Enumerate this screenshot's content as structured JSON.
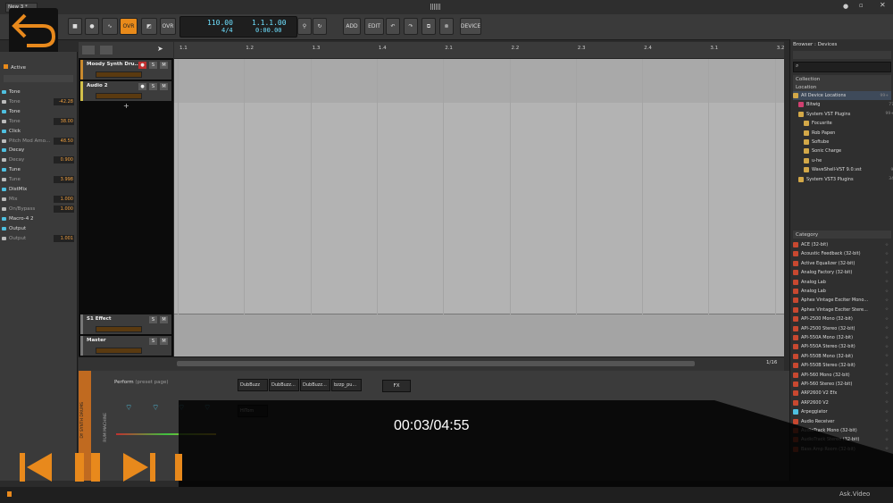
{
  "app": {
    "menu_label": "New 3 *",
    "accent": "#e88a1a"
  },
  "transport": {
    "ovr1": "OVR",
    "ovr2": "OVR",
    "tempo": "110.00",
    "time_sig": "4/4",
    "position": "1.1.1.00",
    "time": "0:00.00",
    "add": "ADD",
    "edit": "EDIT",
    "device": "DEVICE"
  },
  "inspector": {
    "active_label": "Active",
    "rows": [
      {
        "label": "Tone",
        "kind": "head",
        "value": ""
      },
      {
        "label": "Tone",
        "kind": "sub",
        "value": "-42.28"
      },
      {
        "label": "Tone",
        "kind": "head",
        "value": ""
      },
      {
        "label": "Tone",
        "kind": "sub",
        "value": "38.00"
      },
      {
        "label": "Click",
        "kind": "head",
        "value": ""
      },
      {
        "label": "Pitch Mod Amo...",
        "kind": "sub",
        "value": "48.50"
      },
      {
        "label": "Decay",
        "kind": "head",
        "value": ""
      },
      {
        "label": "Decay",
        "kind": "sub",
        "value": "0.900"
      },
      {
        "label": "Tune",
        "kind": "head",
        "value": ""
      },
      {
        "label": "Tune",
        "kind": "sub",
        "value": "3.998"
      },
      {
        "label": "DistMix",
        "kind": "head",
        "value": ""
      },
      {
        "label": "Mix",
        "kind": "sub",
        "value": "1.000"
      },
      {
        "label": "On/Bypass",
        "kind": "sub",
        "value": "1.000"
      },
      {
        "label": "Macro-4 2",
        "kind": "head",
        "value": ""
      },
      {
        "label": "Output",
        "kind": "head",
        "value": ""
      },
      {
        "label": "Output",
        "kind": "sub",
        "value": "1.001"
      }
    ]
  },
  "tracks": [
    {
      "name": "Moody Synth Dru...",
      "color": "#c98a2e"
    },
    {
      "name": "Audio 2",
      "color": "#d2c04a"
    }
  ],
  "fx_tracks": [
    {
      "name": "S1 Effect"
    },
    {
      "name": "Master"
    }
  ],
  "track_buttons": {
    "s": "S",
    "m": "M"
  },
  "ruler": [
    "1.1",
    "1.2",
    "1.3",
    "1.4",
    "2.1",
    "2.2",
    "2.3",
    "2.4",
    "3.1",
    "3.2"
  ],
  "arranger_footer": {
    "grid": "1/16"
  },
  "browser": {
    "title": "Browser : Devices",
    "collection": "Collection",
    "location": "Location",
    "locations": [
      {
        "name": "All Device Locations",
        "count": "99+"
      },
      {
        "name": "Bitwig",
        "count": "77"
      },
      {
        "name": "System VST Plugins",
        "count": "99+"
      },
      {
        "name": "Focusrite",
        "count": "4"
      },
      {
        "name": "Rob Papen",
        "count": "6"
      },
      {
        "name": "Softube",
        "count": "17"
      },
      {
        "name": "Sonic Charge",
        "count": "2"
      },
      {
        "name": "u-he",
        "count": "3"
      },
      {
        "name": "WaveShell-VST 9.0.vst",
        "count": "99+"
      },
      {
        "name": "System VST3 Plugins",
        "count": "34"
      }
    ],
    "category": "Category",
    "devices": [
      "ACE (32-bit)",
      "Acoustic Feedback (32-bit)",
      "Active Equalizer (32-bit)",
      "Analog Factory (32-bit)",
      "Analog Lab",
      "Analog Lab",
      "Aphex Vintage Exciter Mono...",
      "Aphex Vintage Exciter Stere...",
      "API-2500 Mono (32-bit)",
      "API-2500 Stereo (32-bit)",
      "API-550A Mono (32-bit)",
      "API-550A Stereo (32-bit)",
      "API-550B Mono (32-bit)",
      "API-550B Stereo (32-bit)",
      "API-560 Mono (32-bit)",
      "API-560 Stereo (32-bit)",
      "ARP2600 V2 Efx",
      "ARP2600 V2",
      "Arpeggiator",
      "Audio Receiver",
      "AudioTrack Mono (32-bit)",
      "AudioTrack Stereo (32-bit)",
      "Bass Amp Room (32-bit)"
    ]
  },
  "device_panel": {
    "perform_label": "Perform",
    "preset_label": "(preset page)",
    "strip_label": "DY SYNTH DRUMS",
    "machine_label": "RUM MACHINE",
    "pads": [
      "DubBuzz",
      "DubBuzz...",
      "DubBuzz...",
      "bzzp_pu...",
      "HiTom"
    ],
    "fx": "FX"
  },
  "video": {
    "timer": "00:03/04:55"
  },
  "footer_watermark": "Ask.Video"
}
